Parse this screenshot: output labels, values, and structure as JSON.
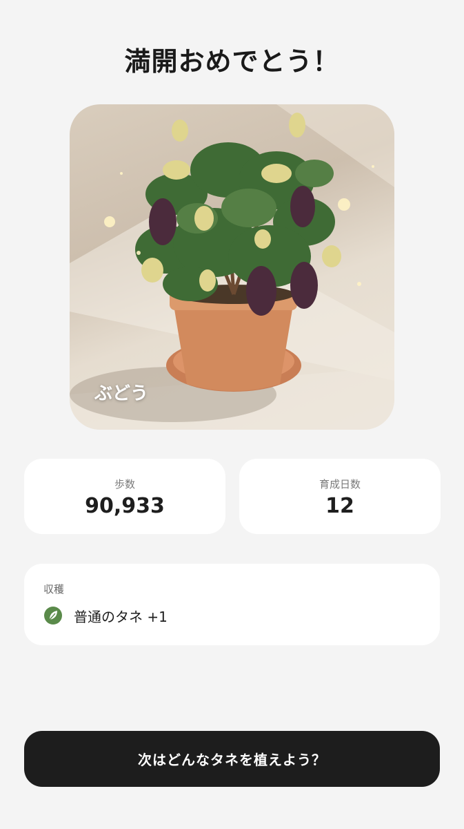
{
  "header": {
    "title": "満開おめでとう！"
  },
  "plant": {
    "name": "ぶどう"
  },
  "stats": [
    {
      "label": "歩数",
      "value": "90,933"
    },
    {
      "label": "育成日数",
      "value": "12"
    }
  ],
  "harvest": {
    "title": "収穫",
    "item": {
      "icon": "leaf-icon",
      "text": "普通のタネ +1",
      "color": "#5a8a4a"
    }
  },
  "cta": {
    "label": "次はどんなタネを植えよう？"
  },
  "colors": {
    "background": "#f4f4f4",
    "card": "#ffffff",
    "button": "#1d1d1d",
    "pot": "#c8835a"
  }
}
